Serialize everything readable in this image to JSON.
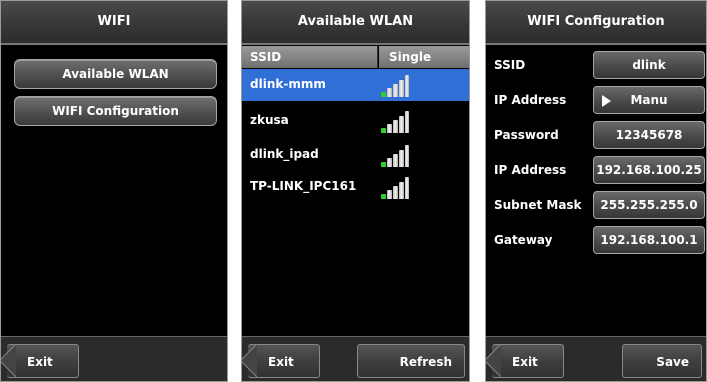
{
  "screen1": {
    "title": "WIFI",
    "buttons": [
      "Available WLAN",
      "WIFI Configuration"
    ],
    "exit": "Exit"
  },
  "screen2": {
    "title": "Available WLAN",
    "headers": [
      "SSID",
      "Single"
    ],
    "networks": [
      {
        "ssid": "dlink-mmm",
        "signal_bars": 1,
        "selected": true
      },
      {
        "ssid": "zkusa",
        "signal_bars": 1,
        "selected": false
      },
      {
        "ssid": "dlink_ipad",
        "signal_bars": 1,
        "selected": false
      },
      {
        "ssid": "TP-LINK_IPC161",
        "signal_bars": 1,
        "selected": false
      }
    ],
    "exit": "Exit",
    "refresh": "Refresh"
  },
  "screen3": {
    "title": "WIFI Configuration",
    "fields": [
      {
        "label": "SSID",
        "value": "dlink"
      },
      {
        "label": "IP Address",
        "value": "Manu"
      },
      {
        "label": "Password",
        "value": "12345678"
      },
      {
        "label": "IP Address",
        "value": "192.168.100.25"
      },
      {
        "label": "Subnet Mask",
        "value": "255.255.255.0"
      },
      {
        "label": "Gateway",
        "value": "192.168.100.1"
      }
    ],
    "exit": "Exit",
    "save": "Save"
  },
  "colors": {
    "selected_row": "#2f6fd6",
    "signal_active": "#2fd12f",
    "background": "#000000"
  }
}
